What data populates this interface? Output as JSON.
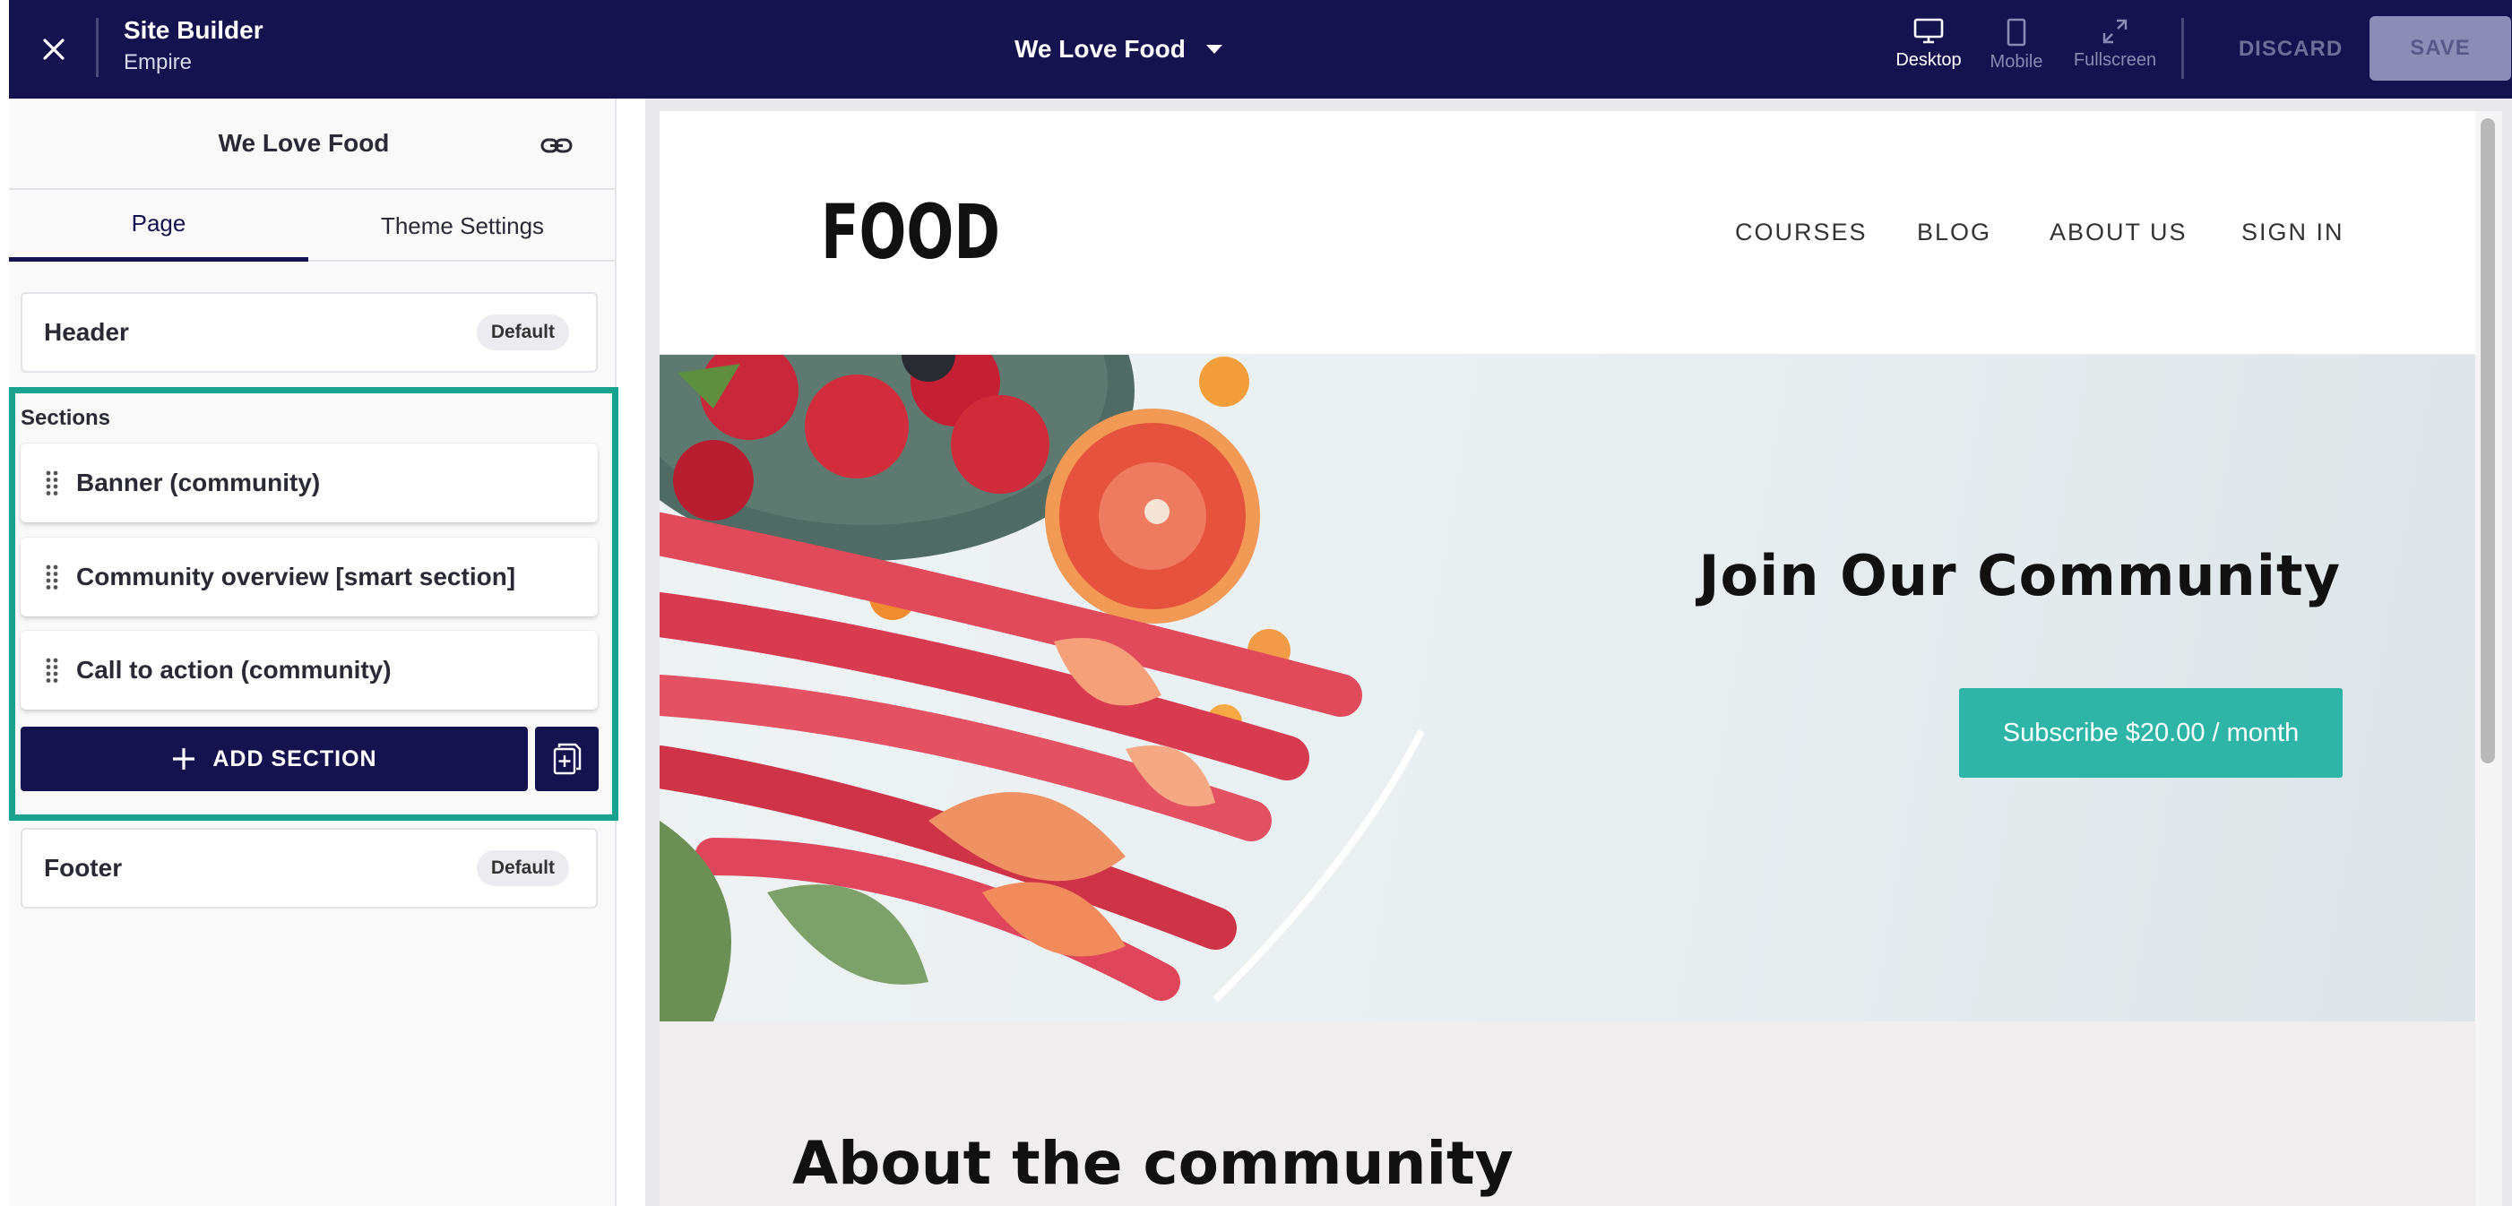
{
  "topbar": {
    "app_title": "Site Builder",
    "app_subtitle": "Empire",
    "site_name": "We Love Food",
    "views": {
      "desktop": "Desktop",
      "mobile": "Mobile",
      "fullscreen": "Fullscreen"
    },
    "discard_label": "DISCARD",
    "save_label": "SAVE"
  },
  "panel": {
    "site_name": "We Love Food",
    "tabs": [
      {
        "label": "Page",
        "active": true
      },
      {
        "label": "Theme Settings",
        "active": false
      }
    ],
    "header": {
      "label": "Header",
      "badge": "Default"
    },
    "sections_title": "Sections",
    "sections": [
      {
        "label": "Banner (community)"
      },
      {
        "label": "Community overview [smart section]"
      },
      {
        "label": "Call to action (community)"
      }
    ],
    "add_section_label": "ADD SECTION",
    "footer": {
      "label": "Footer",
      "badge": "Default"
    }
  },
  "preview": {
    "logo_text": "FOOD",
    "nav": [
      "COURSES",
      "BLOG",
      "ABOUT US",
      "SIGN IN"
    ],
    "banner_title": "Join Our Community",
    "subscribe_label": "Subscribe $20.00 / month",
    "about_title": "About the community"
  },
  "colors": {
    "topbar_bg": "#14134f",
    "accent_teal": "#17a38d",
    "subscribe_bg": "#2eb5a7"
  }
}
